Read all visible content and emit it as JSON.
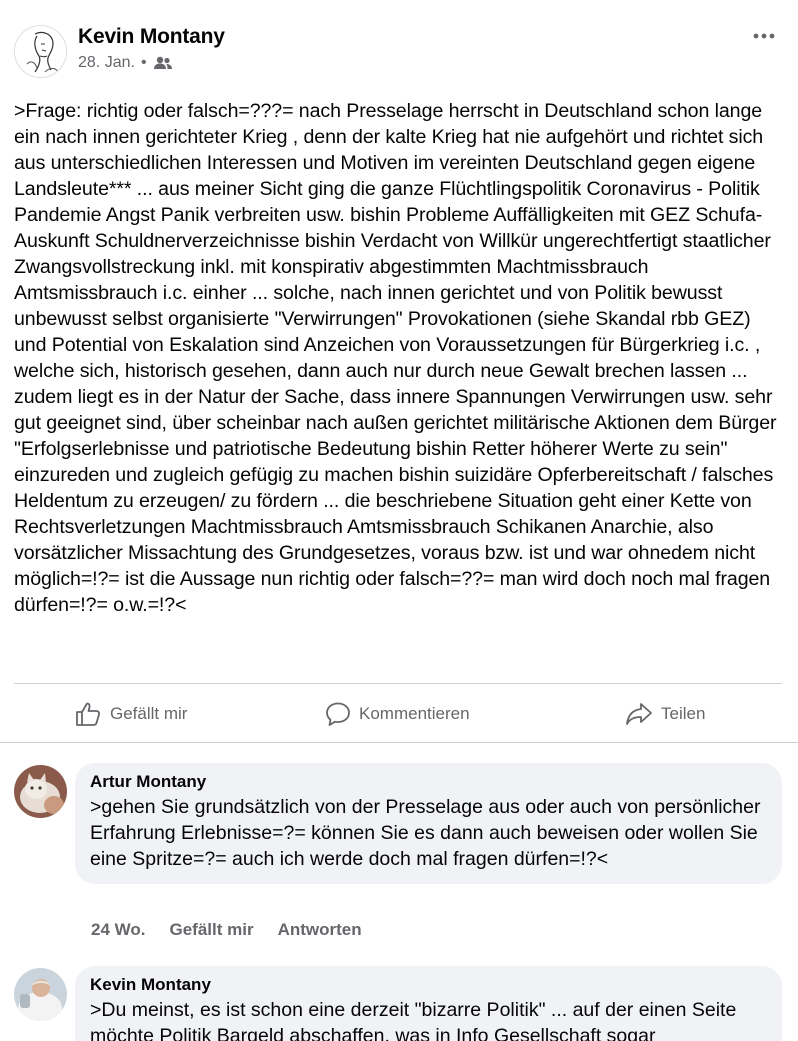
{
  "post": {
    "author": "Kevin Montany",
    "date": "28. Jan.",
    "separator": "•",
    "audience_icon": "friends-icon",
    "text": ">Frage: richtig oder falsch=???= nach Presselage herrscht in Deutschland schon lange ein nach innen gerichteter Krieg , denn der kalte Krieg hat nie aufgehört und richtet sich aus unterschiedlichen Interessen und Motiven im vereinten Deutschland gegen eigene Landsleute*** ... aus meiner Sicht ging die ganze Flüchtlingspolitik Coronavirus - Politik Pandemie Angst Panik verbreiten usw. bishin Probleme Auffälligkeiten mit GEZ Schufa-Auskunft Schuldnerverzeichnisse bishin Verdacht von Willkür ungerechtfertigt staatlicher Zwangsvollstreckung inkl. mit konspirativ abgestimmten Machtmissbrauch Amtsmissbrauch i.c. einher ... solche, nach innen gerichtet und von Politik bewusst unbewusst selbst organisierte \"Verwirrungen\" Provokationen (siehe Skandal rbb GEZ) und Potential von Eskalation sind Anzeichen von Voraussetzungen für Bürgerkrieg i.c. , welche sich, historisch gesehen, dann auch nur durch neue Gewalt brechen lassen ... zudem liegt es in der Natur der Sache, dass innere Spannungen Verwirrungen usw. sehr gut geeignet sind, über scheinbar nach außen gerichtet militärische Aktionen dem Bürger \"Erfolgserlebnisse und patriotische Bedeutung bishin Retter höherer Werte zu sein\" einzureden und zugleich gefügig zu machen bishin suizidäre Opferbereitschaft / falsches Heldentum zu erzeugen/ zu fördern ... die beschriebene Situation geht einer Kette von Rechtsverletzungen Machtmissbrauch Amtsmissbrauch Schikanen Anarchie, also vorsätzlicher Missachtung des Grundgesetzes, voraus bzw. ist und war ohnedem nicht möglich=!?= ist die Aussage nun richtig oder falsch=??= man wird doch noch mal fragen dürfen=!?= o.w.=!?<"
  },
  "actions": {
    "like": "Gefällt mir",
    "comment": "Kommentieren",
    "share": "Teilen"
  },
  "comments": [
    {
      "author": "Artur Montany",
      "text": ">gehen Sie grundsätzlich von der Presselage aus oder auch von persönlicher Erfahrung Erlebnisse=?= können Sie es dann auch beweisen oder wollen Sie eine Spritze=?=  auch ich werde doch mal fragen dürfen=!?<",
      "time": "24 Wo.",
      "like": "Gefällt mir",
      "reply": "Antworten"
    },
    {
      "author": "Kevin Montany",
      "text": ">Du meinst, es ist schon eine derzeit \"bizarre Politik\" ... auf der einen Seite möchte Politik Bargeld abschaffen, was in Info Gesellschaft sogar"
    }
  ],
  "colors": {
    "text": "#050505",
    "secondary": "#65676b",
    "bubble": "#f0f2f5",
    "divider": "#ced0d4"
  }
}
